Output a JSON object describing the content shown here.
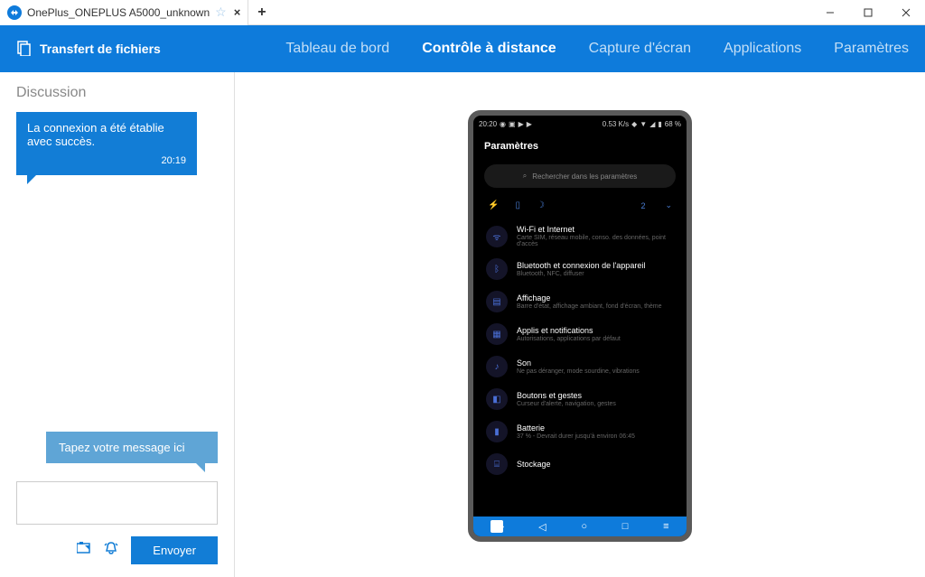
{
  "titlebar": {
    "tab_title": "OnePlus_ONEPLUS A5000_unknown"
  },
  "topnav": {
    "file_transfer": "Transfert de fichiers",
    "items": [
      {
        "label": "Tableau de bord",
        "active": false
      },
      {
        "label": "Contrôle à distance",
        "active": true
      },
      {
        "label": "Capture d'écran",
        "active": false
      },
      {
        "label": "Applications",
        "active": false
      },
      {
        "label": "Paramètres",
        "active": false
      }
    ]
  },
  "chat": {
    "heading": "Discussion",
    "message": "La connexion a été établie avec succès.",
    "time": "20:19",
    "hint": "Tapez votre message ici",
    "send": "Envoyer"
  },
  "phone": {
    "status": {
      "time": "20:20",
      "speed": "0.53 K/s",
      "battery": "68 %"
    },
    "title": "Paramètres",
    "search_placeholder": "Rechercher dans les paramètres",
    "quick_count": "2",
    "settings": [
      {
        "icon": "wifi",
        "title": "Wi-Fi et Internet",
        "sub": "Carte SIM, réseau mobile, conso. des données, point d'accès"
      },
      {
        "icon": "bt",
        "title": "Bluetooth et connexion de l'appareil",
        "sub": "Bluetooth, NFC, diffuser"
      },
      {
        "icon": "display",
        "title": "Affichage",
        "sub": "Barre d'état, affichage ambiant, fond d'écran, thème"
      },
      {
        "icon": "apps",
        "title": "Applis et notifications",
        "sub": "Autorisations, applications par défaut"
      },
      {
        "icon": "sound",
        "title": "Son",
        "sub": "Ne pas déranger, mode sourdine, vibrations"
      },
      {
        "icon": "gesture",
        "title": "Boutons et gestes",
        "sub": "Curseur d'alerte, navigation, gestes"
      },
      {
        "icon": "battery",
        "title": "Batterie",
        "sub": "37 % - Devrait durer jusqu'à environ 06:45"
      },
      {
        "icon": "storage",
        "title": "Stockage",
        "sub": ""
      }
    ]
  }
}
